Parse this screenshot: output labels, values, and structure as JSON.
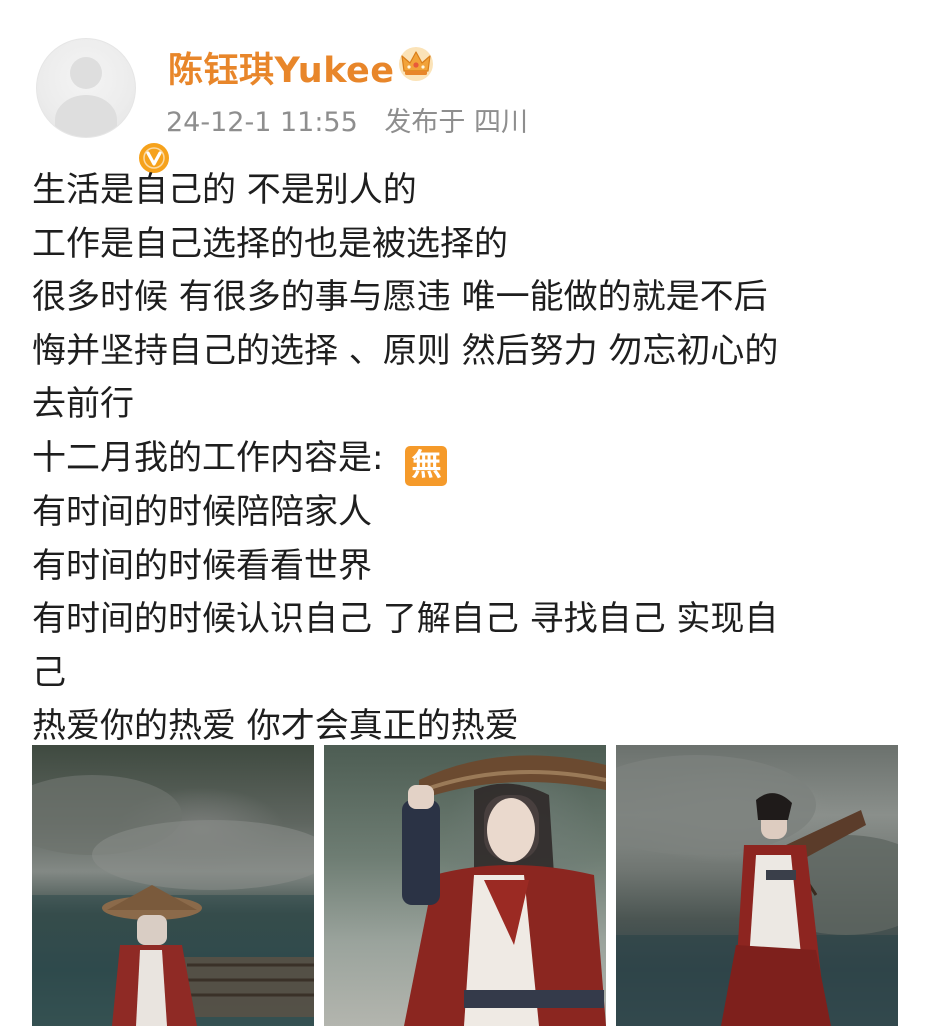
{
  "post": {
    "author": {
      "name": "陈钰琪Yukee",
      "badge_icon": "verified-v-icon",
      "crown_icon": "crown-icon",
      "name_color": "#e8862a",
      "badge_color": "#f6a21c"
    },
    "meta": {
      "time": "24-12-1 11:55",
      "location": "发布于 四川"
    },
    "content_lines": [
      "生活是自己的 不是别人的",
      "工作是自己选择的也是被选择的",
      "很多时候 有很多的事与愿违 唯一能做的就是不后",
      "悔并坚持自己的选择 、原则 然后努力 勿忘初心的",
      "去前行",
      "十二月我的工作内容是:",
      "有时间的时候陪陪家人",
      "有时间的时候看看世界",
      "有时间的时候认识自己 了解自己 寻找自己 实现自",
      "己",
      "热爱你的热爱 你才会真正的热爱"
    ],
    "emoji": {
      "name": "wu-emoji",
      "glyph": "無",
      "color": "#f59a2a"
    },
    "images": [
      {
        "name": "photo-1-river-bamboo-hat"
      },
      {
        "name": "photo-2-portrait-bamboo-hat"
      },
      {
        "name": "photo-3-rocks-umbrella"
      }
    ]
  }
}
